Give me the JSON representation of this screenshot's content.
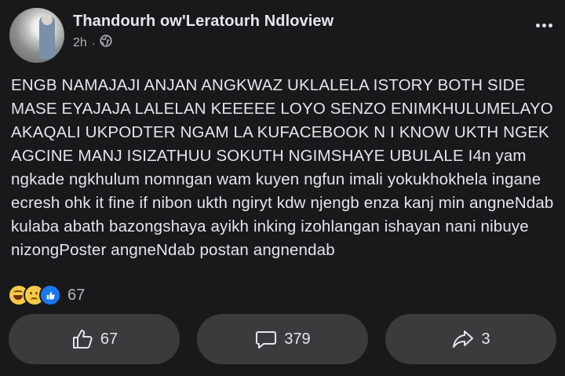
{
  "post": {
    "author": "Thandourh ow'Leratourh Ndloview",
    "time": "2h",
    "separator": "·",
    "privacy_icon": "globe-icon",
    "text": "ENGB NAMAJAJI ANJAN ANGKWAZ UKLALELA ISTORY BOTH SIDE MASE EYAJAJA LALELAN KEEEEE LOYO SENZO ENIMKHULUMELAYO AKAQALI UKPODTER NGAM LA KUFACEBOOK N I KNOW UKTH NGEK AGCINE MANJ ISIZATHUU SOKUTH NGIMSHAYE UBULALE I4n yam ngkade ngkhulum nomngan wam kuyen ngfun imali yokukhokhela ingane ecresh ohk it fine if nibon ukth ngiryt kdw njengb enza kanj min angneNdab kulaba abath bazongshaya ayikh inking izohlangan ishayan nani nibuye nizongPoster angneNdab postan angnendab"
  },
  "reactions": {
    "icons": [
      "haha-reaction-icon",
      "sad-reaction-icon",
      "like-reaction-icon"
    ],
    "count": "67"
  },
  "actions": {
    "like_count": "67",
    "comment_count": "379",
    "share_count": "3"
  },
  "colors": {
    "background": "#18191a",
    "button_bg": "#3a3b3c",
    "text_primary": "#e4e6eb",
    "text_secondary": "#b0b3b8",
    "like_blue": "#1877f2"
  }
}
